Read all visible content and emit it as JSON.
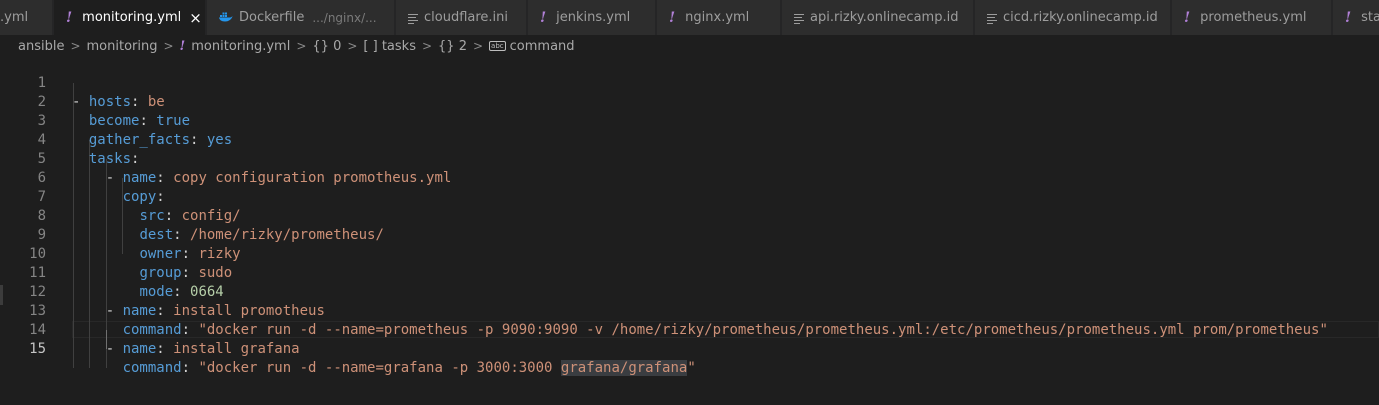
{
  "tabs": [
    {
      "label": ".yml",
      "icon": "yaml-icon",
      "active": false
    },
    {
      "label": "monitoring.yml",
      "icon": "yaml-icon",
      "active": true,
      "close": "×"
    },
    {
      "label": "Dockerfile",
      "description": ".../nginx/...",
      "icon": "docker-icon",
      "active": false
    },
    {
      "label": "cloudflare.ini",
      "icon": "text-lines-icon",
      "active": false
    },
    {
      "label": "jenkins.yml",
      "icon": "yaml-icon",
      "active": false
    },
    {
      "label": "nginx.yml",
      "icon": "yaml-icon",
      "active": false
    },
    {
      "label": "api.rizky.onlinecamp.id",
      "icon": "text-lines-icon",
      "active": false
    },
    {
      "label": "cicd.rizky.onlinecamp.id",
      "icon": "text-lines-icon",
      "active": false
    },
    {
      "label": "prometheus.yml",
      "icon": "yaml-icon",
      "active": false
    },
    {
      "label": "sta",
      "icon": "yaml-icon",
      "active": false
    }
  ],
  "icons": {
    "yaml": "!",
    "docker": "🐳",
    "close": "×"
  },
  "breadcrumb": {
    "folder1": "ansible",
    "folder2": "monitoring",
    "file": "monitoring.yml",
    "obj0": "{} 0",
    "arr": "[ ] tasks",
    "obj2": "{} 2",
    "prop_icon": "abc",
    "prop": "command"
  },
  "editor": {
    "active_line": 15,
    "lines": [
      {
        "no": "1",
        "text": "- hosts: be"
      },
      {
        "no": "2",
        "text": "  become: true"
      },
      {
        "no": "3",
        "text": "  gather_facts: yes"
      },
      {
        "no": "4",
        "text": "  tasks:"
      },
      {
        "no": "5",
        "text": "    - name: copy configuration promotheus.yml"
      },
      {
        "no": "6",
        "text": "      copy:"
      },
      {
        "no": "7",
        "text": "        src: config/"
      },
      {
        "no": "8",
        "text": "        dest: /home/rizky/prometheus/"
      },
      {
        "no": "9",
        "text": "        owner: rizky"
      },
      {
        "no": "10",
        "text": "        group: sudo"
      },
      {
        "no": "11",
        "text": "        mode: 0664"
      },
      {
        "no": "12",
        "text": "    - name: install promotheus"
      },
      {
        "no": "13",
        "text": "      command: \"docker run -d --name=prometheus -p 9090:9090 -v /home/rizky/prometheus/prometheus.yml:/etc/prometheus/prometheus.yml prom/prometheus\""
      },
      {
        "no": "14",
        "text": "    - name: install grafana"
      },
      {
        "no": "15",
        "text": "      command: \"docker run -d --name=grafana -p 3000:3000 grafana/grafana\""
      }
    ]
  },
  "colors": {
    "key": "#569cd6",
    "string": "#ce9178",
    "number": "#b5cea8",
    "yaml_icon": "#b180d7",
    "docker_icon": "#2496ed",
    "background": "#1e1e1e"
  }
}
